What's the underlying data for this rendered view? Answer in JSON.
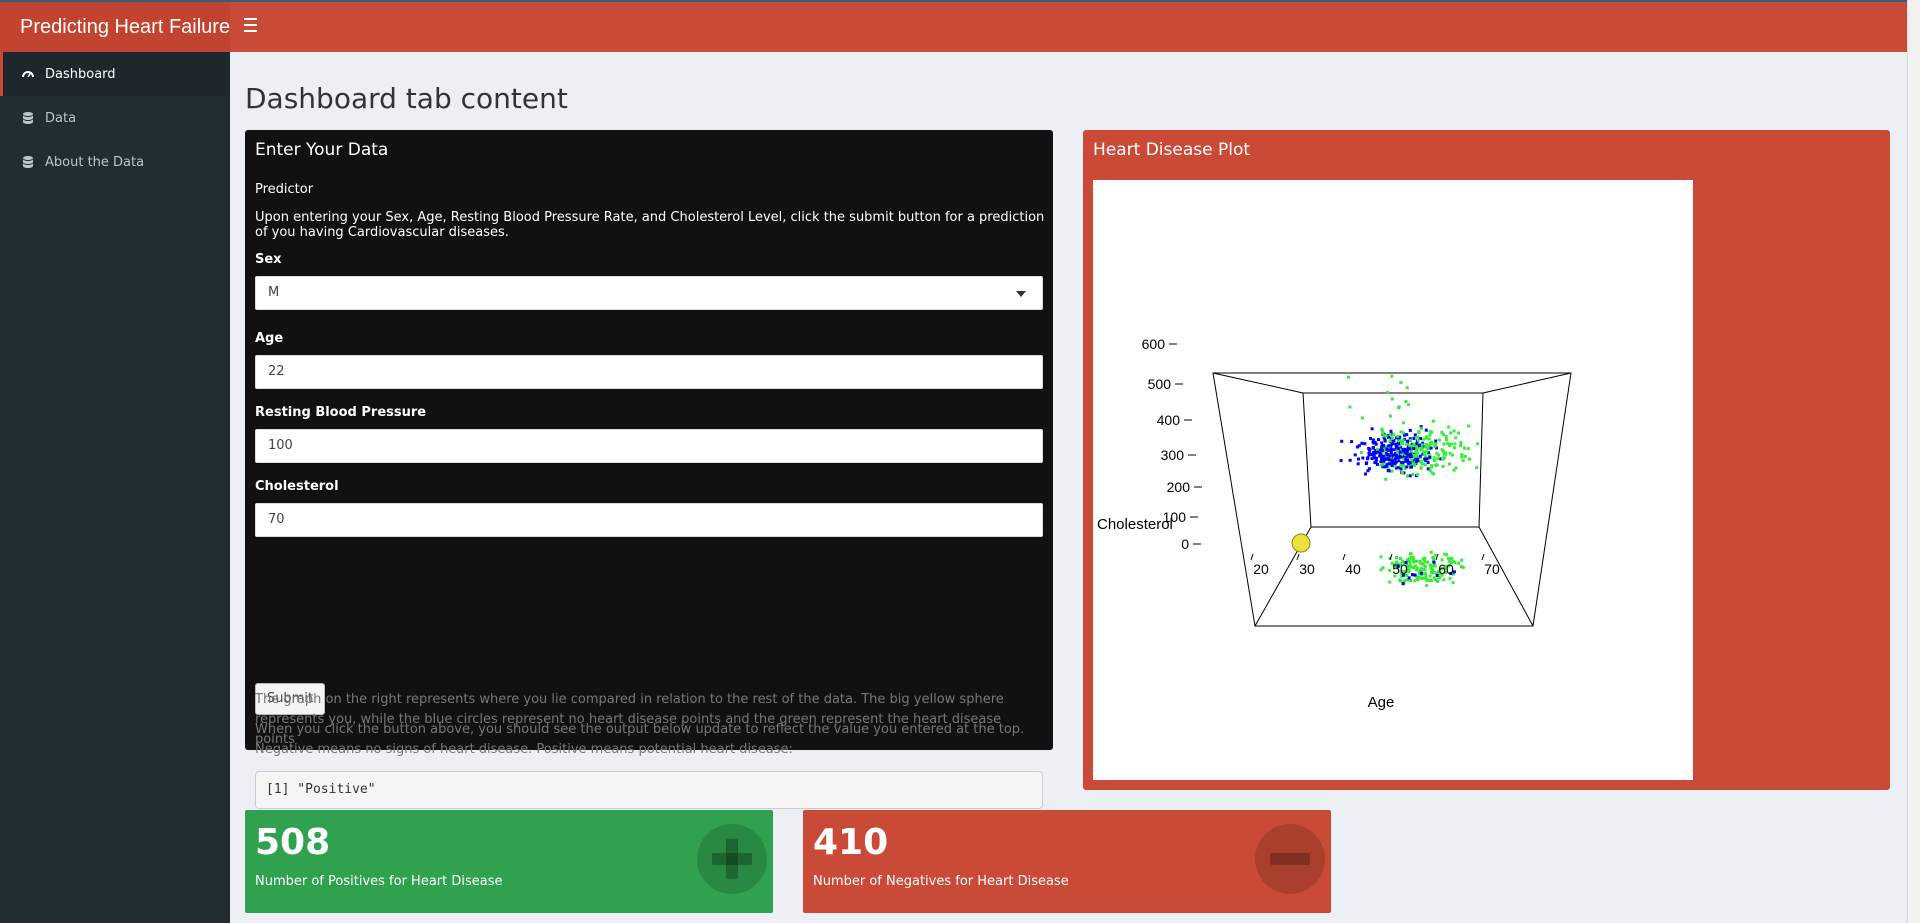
{
  "header": {
    "brand": "Predicting Heart Failure"
  },
  "sidebar": {
    "items": [
      {
        "label": "Dashboard",
        "icon": "dashboard-icon",
        "active": true
      },
      {
        "label": "Data",
        "icon": "database-icon"
      },
      {
        "label": "About the Data",
        "icon": "database-icon"
      }
    ]
  },
  "main": {
    "title": "Dashboard tab content",
    "input_box": {
      "title": "Enter Your Data",
      "predictor_label": "Predictor",
      "instructions": "Upon entering your Sex, Age, Resting Blood Pressure Rate, and Cholesterol Level, click the submit button for a prediction of you having Cardiovascular diseases.",
      "sex_label": "Sex",
      "sex_value": "M",
      "age_label": "Age",
      "age_value": "22",
      "bp_label": "Resting Blood Pressure",
      "bp_value": "100",
      "chol_label": "Cholesterol",
      "chol_value": "70",
      "submit_label": "Submit",
      "help_text": "When you click the button above, you should see the output below update to reflect the value you entered at the top. Negative means no signs of heart disease. Positive means potential heart disease:",
      "output": "[1] \"Positive\"",
      "graph_note": "The graph on the right represents where you lie compared in relation to the rest of the data. The big yellow sphere represents you, while the blue circles represent no heart disease points and the green represent the heart disease points"
    },
    "plot_box": {
      "title": "Heart Disease Plot",
      "z_label": "Cholesterol",
      "x_label": "Age",
      "z_ticks": [
        "600",
        "500",
        "400",
        "300",
        "200",
        "100",
        "0"
      ],
      "x_ticks": [
        "20",
        "30",
        "40",
        "50",
        "60",
        "70"
      ],
      "colors": {
        "negative": "#0000ff",
        "positive": "#33ee33",
        "you": "#e8e23a"
      }
    },
    "value_boxes": [
      {
        "value": "508",
        "label": "Number of Positives for Heart Disease",
        "color": "#30a14e",
        "icon": "plus-icon"
      },
      {
        "value": "410",
        "label": "Number of Negatives for Heart Disease",
        "color": "#c94b37",
        "icon": "minus-icon"
      }
    ]
  }
}
